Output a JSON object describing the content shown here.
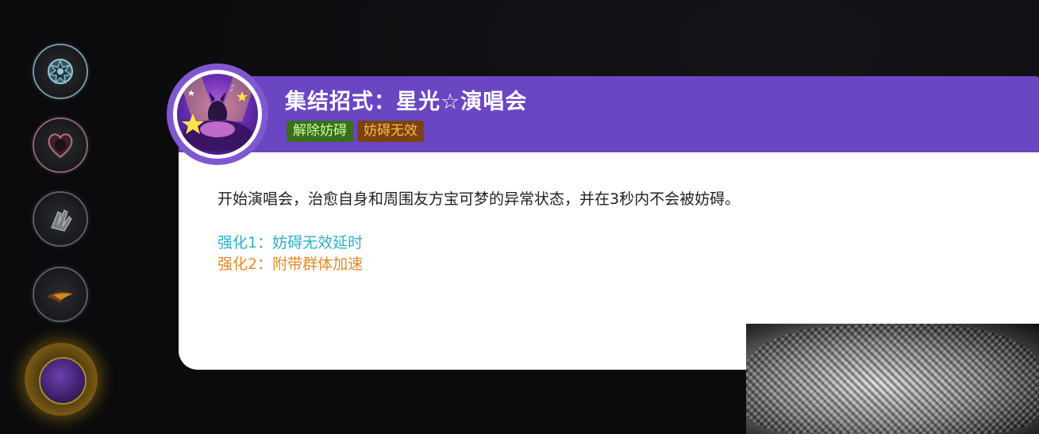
{
  "skill_tooltip": {
    "title": "集结招式：星光☆演唱会",
    "tags": [
      "解除妨碍",
      "妨碍无效"
    ],
    "description": "开始演唱会，治愈自身和周围友方宝可梦的异常状态，并在3秒内不会被妨碍。",
    "enhancements": [
      "强化1：妨碍无效延时",
      "强化2：附带群体加速"
    ]
  },
  "colors": {
    "header": "#6a46c3",
    "tag_green_bg": "#3a6d1e",
    "tag_green_text": "#c9ff9c",
    "tag_orange_bg": "#7a4410",
    "tag_orange_text": "#ffba4a",
    "enh1": "#2bb0c8",
    "enh2": "#e4892a"
  },
  "icons": {
    "skill_1": "gear-burst-icon",
    "skill_2": "heart-silhouette-icon",
    "skill_3": "hand-wave-icon",
    "skill_4": "fire-swirl-icon",
    "skill_selected": "star-concert-icon"
  }
}
